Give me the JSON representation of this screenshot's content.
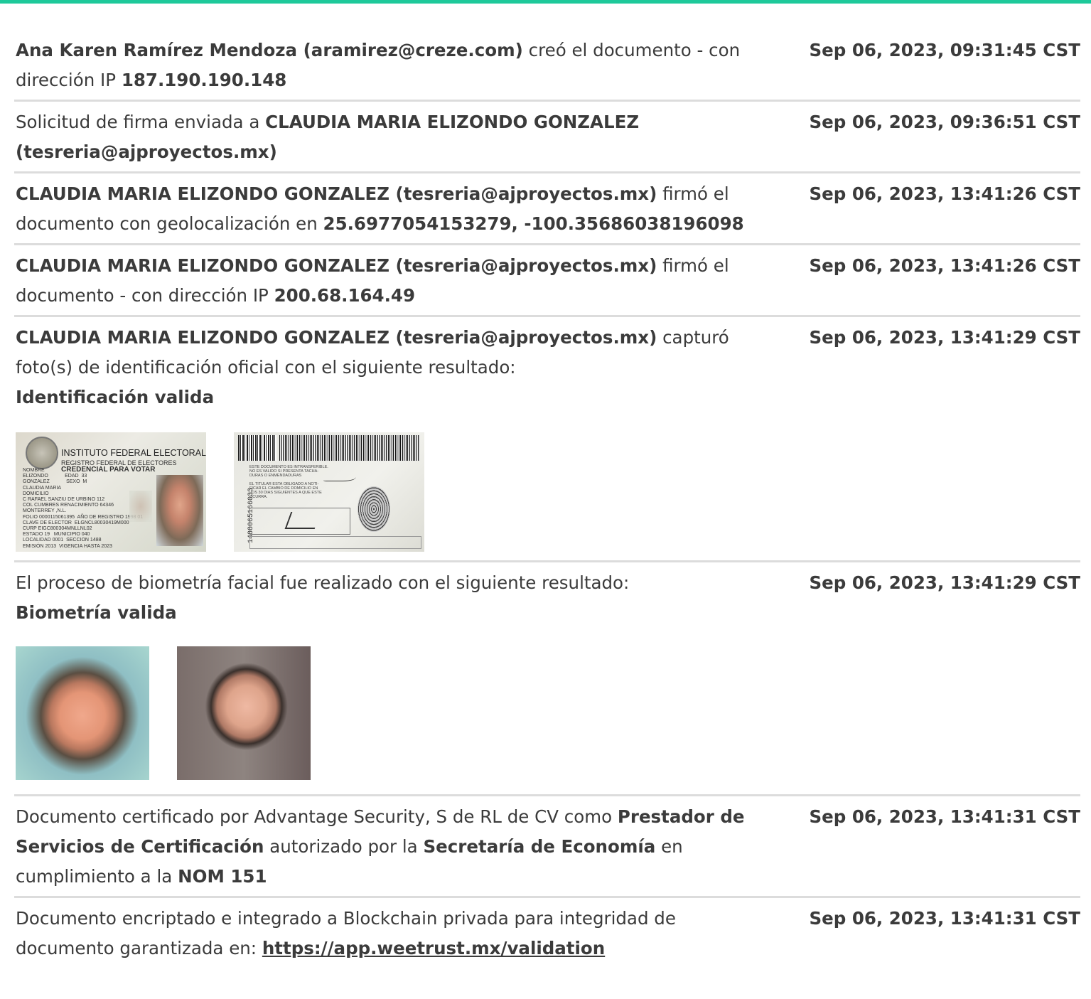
{
  "rows": [
    {
      "parts": [
        {
          "t": "Ana Karen Ramírez Mendoza (aramirez@creze.com)",
          "b": true
        },
        {
          "t": " creó el documento - con dirección IP ",
          "b": false
        },
        {
          "t": "187.190.190.148",
          "b": true
        }
      ],
      "ts": "Sep 06, 2023, 09:31:45 CST"
    },
    {
      "parts": [
        {
          "t": "Solicitud de firma enviada a ",
          "b": false
        },
        {
          "t": "CLAUDIA MARIA ELIZONDO GONZALEZ (tesreria@ajproyectos.mx)",
          "b": true
        }
      ],
      "ts": "Sep 06, 2023, 09:36:51 CST"
    },
    {
      "parts": [
        {
          "t": "CLAUDIA MARIA ELIZONDO GONZALEZ (tesreria@ajproyectos.mx)",
          "b": true
        },
        {
          "t": " firmó el documento con geolocalización en ",
          "b": false
        },
        {
          "t": "25.6977054153279, -100.35686038196098",
          "b": true
        }
      ],
      "ts": "Sep 06, 2023, 13:41:26 CST"
    },
    {
      "parts": [
        {
          "t": "CLAUDIA MARIA ELIZONDO GONZALEZ (tesreria@ajproyectos.mx)",
          "b": true
        },
        {
          "t": " firmó el documento - con dirección IP ",
          "b": false
        },
        {
          "t": "200.68.164.49",
          "b": true
        }
      ],
      "ts": "Sep 06, 2023, 13:41:26 CST"
    },
    {
      "parts": [
        {
          "t": "CLAUDIA MARIA ELIZONDO GONZALEZ (tesreria@ajproyectos.mx)",
          "b": true
        },
        {
          "t": " capturó foto(s) de identificación oficial con el siguiente resultado:",
          "b": false
        },
        {
          "t": "Identificación valida",
          "b": true,
          "br": true
        }
      ],
      "ts": "Sep 06, 2023, 13:41:29 CST",
      "images": "id"
    },
    {
      "parts": [
        {
          "t": "El proceso de biometría facial fue realizado con el siguiente resultado:",
          "b": false
        },
        {
          "t": "Biometría valida",
          "b": true,
          "br": true
        }
      ],
      "ts": "Sep 06, 2023, 13:41:29 CST",
      "images": "face"
    },
    {
      "parts": [
        {
          "t": "Documento certificado por Advantage Security, S de RL de CV como ",
          "b": false
        },
        {
          "t": "Prestador de Servicios de Certificación",
          "b": true
        },
        {
          "t": " autorizado por la ",
          "b": false
        },
        {
          "t": "Secretaría de Economía",
          "b": true
        },
        {
          "t": " en cumplimiento a la ",
          "b": false
        },
        {
          "t": "NOM 151",
          "b": true
        }
      ],
      "ts": "Sep 06, 2023, 13:41:31 CST"
    },
    {
      "parts": [
        {
          "t": "Documento encriptado e integrado a Blockchain privada para integridad de documento garantizada en: ",
          "b": false
        },
        {
          "t": "https://app.weetrust.mx/validation",
          "b": true,
          "link": true
        }
      ],
      "ts": "Sep 06, 2023, 13:41:31 CST",
      "noborder": true
    }
  ],
  "id_front": {
    "title": "INSTITUTO FEDERAL ELECTORAL",
    "sub": "REGISTRO FEDERAL DE ELECTORES",
    "sub2": "CREDENCIAL PARA VOTAR",
    "body": "NOMBRE\nELIZONDO            EDAD  33\nGONZALEZ            SEXO  M\nCLAUDIA MARIA\nDOMICILIO\nC RAFAEL SANZIU DE URBINO 112\nCOL CUMBRES RENACIMIENTO 64346\nMONTERREY ,N.L.\nFOLIO 0000115061395  AÑO DE REGISTRO 1998 01\nCLAVE DE ELECTOR  ELGNCL80030419M000\nCURP EIGC800304MNLLNL02\nESTADO 19   MUNICIPIO 040\nLOCALIDAD 0001  SECCION 1488\nEMISIÓN 2013  VIGENCIA HASTA 2023"
  },
  "id_back": {
    "vnum": "1488065166033",
    "text": "ESTE DOCUMENTO ES INTRANSFERIBLE.\nNO ES VALIDO SI PRESENTA TACHA-\nDURAS O ENMENDADURAS\n\nEL TITULAR ESTA OBLIGADO A NOTI-\nFICAR EL CAMBIO DE DOMICILIO EN\nLOS 30 DIAS SIGUIENTES A QUE ESTE\nOCURRA."
  }
}
